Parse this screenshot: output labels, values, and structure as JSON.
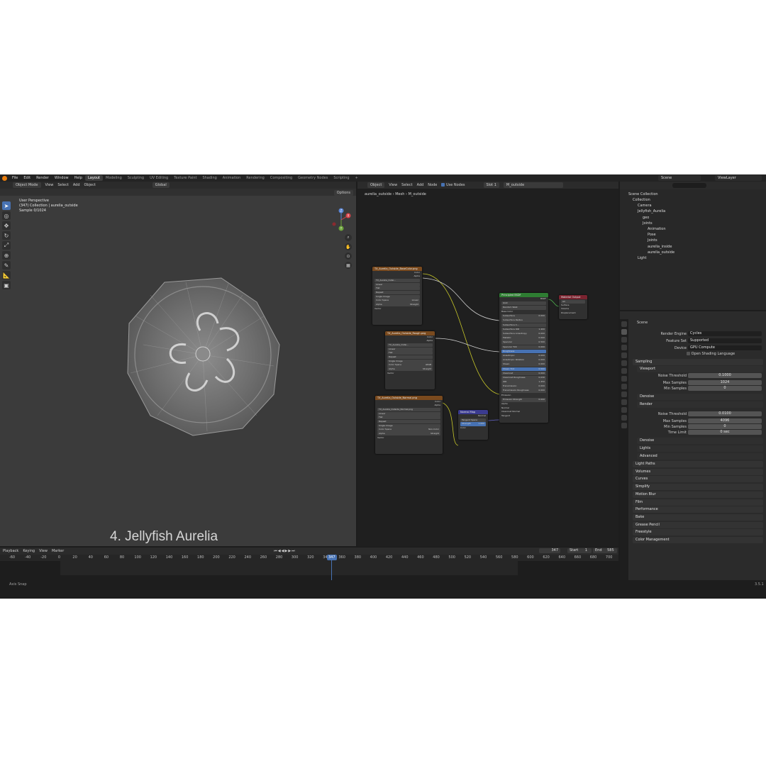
{
  "topbar": {
    "menus": [
      "File",
      "Edit",
      "Render",
      "Window",
      "Help"
    ],
    "workspaces": [
      "Layout",
      "Modeling",
      "Sculpting",
      "UV Editing",
      "Texture Paint",
      "Shading",
      "Animation",
      "Rendering",
      "Compositing",
      "Geometry Nodes",
      "Scripting"
    ],
    "active_workspace": "Layout",
    "add_tab": "+",
    "scene": "Scene",
    "view_layer": "ViewLayer"
  },
  "viewport": {
    "mode": "Object Mode",
    "menus": [
      "View",
      "Select",
      "Add",
      "Object"
    ],
    "orientation": "Global",
    "options": "Options",
    "info_line1": "User Perspective",
    "info_line2": "(347) Collection | aurelia_outside",
    "info_line3": "Sample 0/1024",
    "caption": "4. Jellyfish Aurelia",
    "gizmo": {
      "z": "Z",
      "y": "Y",
      "x": "X"
    }
  },
  "node_editor": {
    "mode": "Object",
    "menus": [
      "View",
      "Select",
      "Add",
      "Node"
    ],
    "use_nodes": "Use Nodes",
    "slot": "Slot 1",
    "material": "M_outside",
    "breadcrumb": [
      "aurelia_outside",
      "Mesh",
      "M_outside"
    ],
    "nodes": {
      "tex1": {
        "title": "TX_Aurelia_Outside_BaseColor.png",
        "image": "TX_Aurelia_Outsi...",
        "rows": [
          "Linear",
          "Flat",
          "Repeat",
          "Single Image"
        ],
        "color_space": [
          "Color Space",
          "Linear"
        ],
        "alpha": [
          "Alpha",
          "Straight"
        ],
        "vector": "Vector",
        "out_color": "Color",
        "out_alpha": "Alpha"
      },
      "tex2": {
        "title": "TX_Aurelia_Outside_Rough.png",
        "image": "TX_Aurelia_Outsi...",
        "rows": [
          "Linear",
          "Flat",
          "Repeat",
          "Single Image"
        ],
        "color_space": [
          "Color Space",
          "sRGB"
        ],
        "alpha": [
          "Alpha",
          "Straight"
        ],
        "vector": "Vector",
        "out_color": "Color",
        "out_alpha": "Alpha"
      },
      "tex3": {
        "title": "TX_Aurelia_Outside_Normal.png",
        "image": "TX_Aurelia_Outside_Normal.png",
        "rows": [
          "Linear",
          "Flat",
          "Repeat",
          "Single Image"
        ],
        "color_space": [
          "Color Space",
          "Non-Color"
        ],
        "alpha": [
          "Alpha",
          "Straight"
        ],
        "vector": "Vector",
        "out_color": "Color",
        "out_alpha": "Alpha"
      },
      "normal_map": {
        "title": "Normal Map",
        "out": "Normal",
        "space": "Tangent Space",
        "strength": [
          "Strength",
          "1.000"
        ],
        "color": "Color"
      },
      "bsdf": {
        "title": "Principled BSDF",
        "out": "BSDF",
        "rows": [
          "GGX",
          "Random Walk",
          "Base Color",
          "Subsurface",
          "Subsurface Radius",
          "Subsurface C...",
          "Subsurface IOR",
          "Subsurface Anisotropy",
          "Metallic",
          "Specular",
          "Specular Tint",
          "Roughness",
          "Anisotropic",
          "Anisotropic Rotation",
          "Sheen",
          "Sheen Tint",
          "Clearcoat",
          "Clearcoat Roughness",
          "IOR",
          "Transmission",
          "Transmission Roughness",
          "Emission",
          "Emission Strength",
          "Alpha",
          "Normal",
          "Clearcoat Normal",
          "Tangent"
        ],
        "values": [
          "",
          "",
          "",
          "0.000",
          "",
          "",
          "1.400",
          "0.000",
          "0.000",
          "0.500",
          "0.000",
          "",
          "0.000",
          "0.000",
          "0.000",
          "0.500",
          "0.000",
          "0.030",
          "1.450",
          "0.000",
          "0.000",
          "",
          "0.000",
          "",
          "",
          "",
          ""
        ]
      },
      "output": {
        "title": "Material Output",
        "target": "All",
        "rows": [
          "Surface",
          "Volume",
          "Displacement"
        ]
      }
    }
  },
  "outliner": {
    "root": "Scene Collection",
    "items": [
      {
        "label": "Collection",
        "indent": 0
      },
      {
        "label": "Camera",
        "indent": 1
      },
      {
        "label": "Jellyfish_Aurelia",
        "indent": 1
      },
      {
        "label": "geo",
        "indent": 2
      },
      {
        "label": "Joints",
        "indent": 2
      },
      {
        "label": "Animation",
        "indent": 3
      },
      {
        "label": "Pose",
        "indent": 3
      },
      {
        "label": "Joints",
        "indent": 3
      },
      {
        "label": "aurelia_inside",
        "indent": 3
      },
      {
        "label": "aurelia_outside",
        "indent": 3
      },
      {
        "label": "Light",
        "indent": 1
      }
    ]
  },
  "properties": {
    "context": "Scene",
    "render_engine": [
      "Render Engine",
      "Cycles"
    ],
    "feature_set": [
      "Feature Set",
      "Supported"
    ],
    "device": [
      "Device",
      "GPU Compute"
    ],
    "osl": "Open Shading Language",
    "sampling": "Sampling",
    "viewport": "Viewport",
    "noise_threshold_vp": [
      "Noise Threshold",
      "0.1000"
    ],
    "max_samples_vp": [
      "Max Samples",
      "1024"
    ],
    "min_samples_vp": [
      "Min Samples",
      "0"
    ],
    "denoise_vp": "Denoise",
    "render": "Render",
    "noise_threshold_r": [
      "Noise Threshold",
      "0.0100"
    ],
    "max_samples_r": [
      "Max Samples",
      "4096"
    ],
    "min_samples_r": [
      "Min Samples",
      "0"
    ],
    "time_limit": [
      "Time Limit",
      "0 sec"
    ],
    "denoise_r": "Denoise",
    "lights": "Lights",
    "advanced": "Advanced",
    "sections": [
      "Light Paths",
      "Volumes",
      "Curves",
      "Simplify",
      "Motion Blur",
      "Film",
      "Performance",
      "Bake",
      "Grease Pencil",
      "Freestyle",
      "Color Management"
    ]
  },
  "timeline": {
    "menus": [
      "Playback",
      "Keying",
      "View",
      "Marker"
    ],
    "current_frame": "347",
    "start_label": "Start",
    "start": "1",
    "end_label": "End",
    "end": "585",
    "ruler": [
      "-60",
      "-40",
      "-20",
      "0",
      "20",
      "40",
      "60",
      "80",
      "100",
      "120",
      "140",
      "160",
      "180",
      "200",
      "220",
      "240",
      "260",
      "280",
      "300",
      "320",
      "340",
      "360",
      "380",
      "400",
      "420",
      "440",
      "460",
      "480",
      "500",
      "520",
      "540",
      "560",
      "580",
      "600",
      "620",
      "640",
      "660",
      "680",
      "700"
    ]
  },
  "status": {
    "left": "Axis Snap",
    "version": "3.5.1"
  }
}
